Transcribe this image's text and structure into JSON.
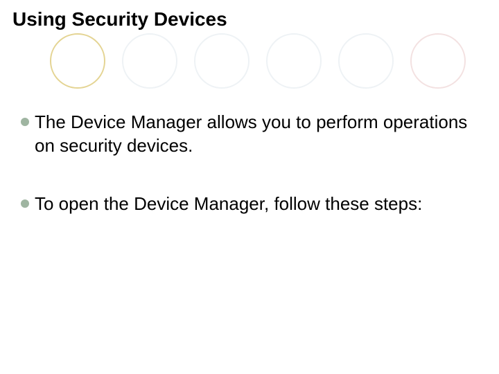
{
  "slide": {
    "title": "Using Security Devices",
    "bullets": [
      "The Device Manager allows you to perform operations on security devices.",
      "To open the Device Manager, follow these steps:"
    ]
  }
}
